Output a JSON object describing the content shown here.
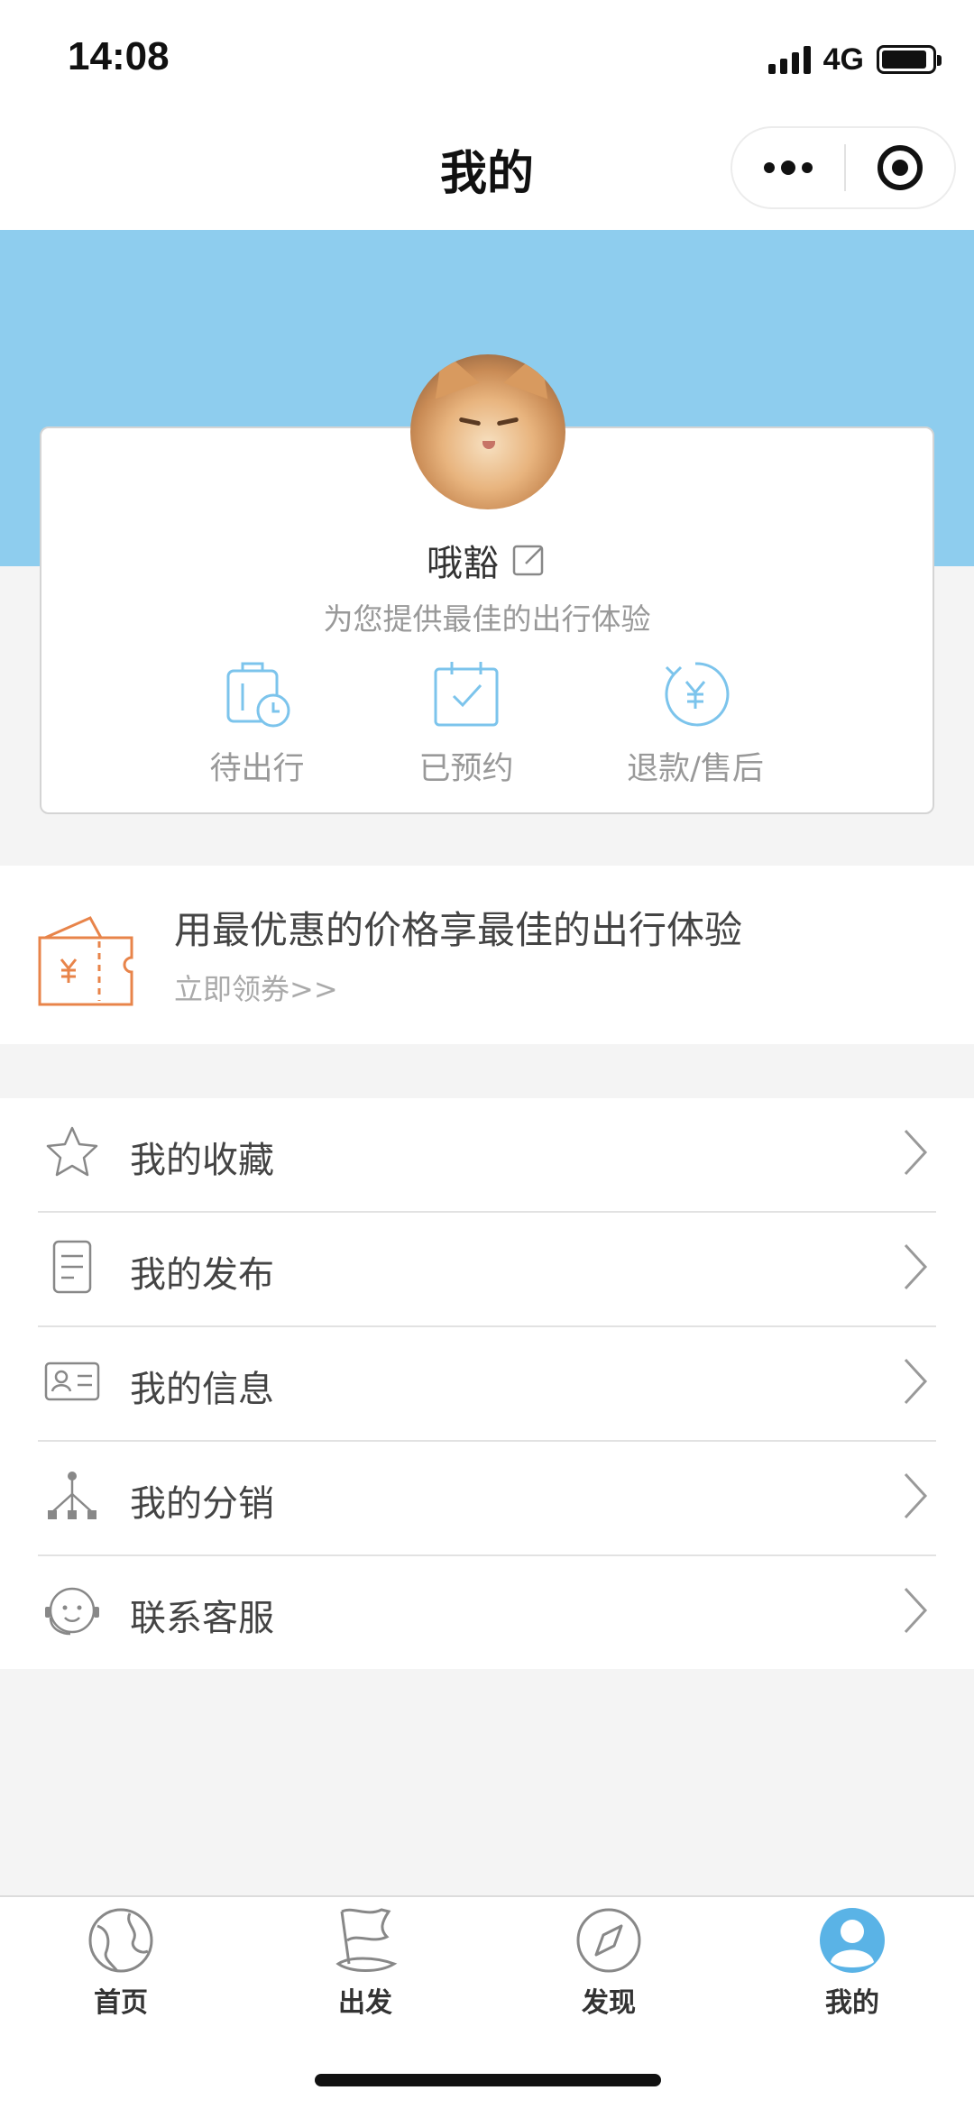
{
  "status_bar": {
    "time": "14:08",
    "network": "4G",
    "battery_percent": 90
  },
  "nav": {
    "title": "我的"
  },
  "profile": {
    "username": "哦豁",
    "tagline": "为您提供最佳的出行体验",
    "quick_actions": [
      {
        "label": "待出行",
        "icon": "luggage-clock-icon"
      },
      {
        "label": "已预约",
        "icon": "calendar-check-icon"
      },
      {
        "label": "退款/售后",
        "icon": "refund-yen-icon"
      }
    ]
  },
  "coupon": {
    "title": "用最优惠的价格享最佳的出行体验",
    "link": "立即领券>>",
    "icon": "coupon-wallet-icon"
  },
  "menu": [
    {
      "label": "我的收藏",
      "icon": "star-icon"
    },
    {
      "label": "我的发布",
      "icon": "document-icon"
    },
    {
      "label": "我的信息",
      "icon": "id-card-icon"
    },
    {
      "label": "我的分销",
      "icon": "distribution-tree-icon"
    },
    {
      "label": "联系客服",
      "icon": "customer-service-icon"
    }
  ],
  "tabs": [
    {
      "label": "首页",
      "icon": "globe-icon"
    },
    {
      "label": "出发",
      "icon": "flag-icon"
    },
    {
      "label": "发现",
      "icon": "compass-icon"
    },
    {
      "label": "我的",
      "icon": "user-icon",
      "active": true
    }
  ],
  "colors": {
    "banner": "#8ecdee",
    "accent_blue": "#5ab3e6",
    "coupon_orange": "#e8844a",
    "icon_grey": "#888888"
  }
}
